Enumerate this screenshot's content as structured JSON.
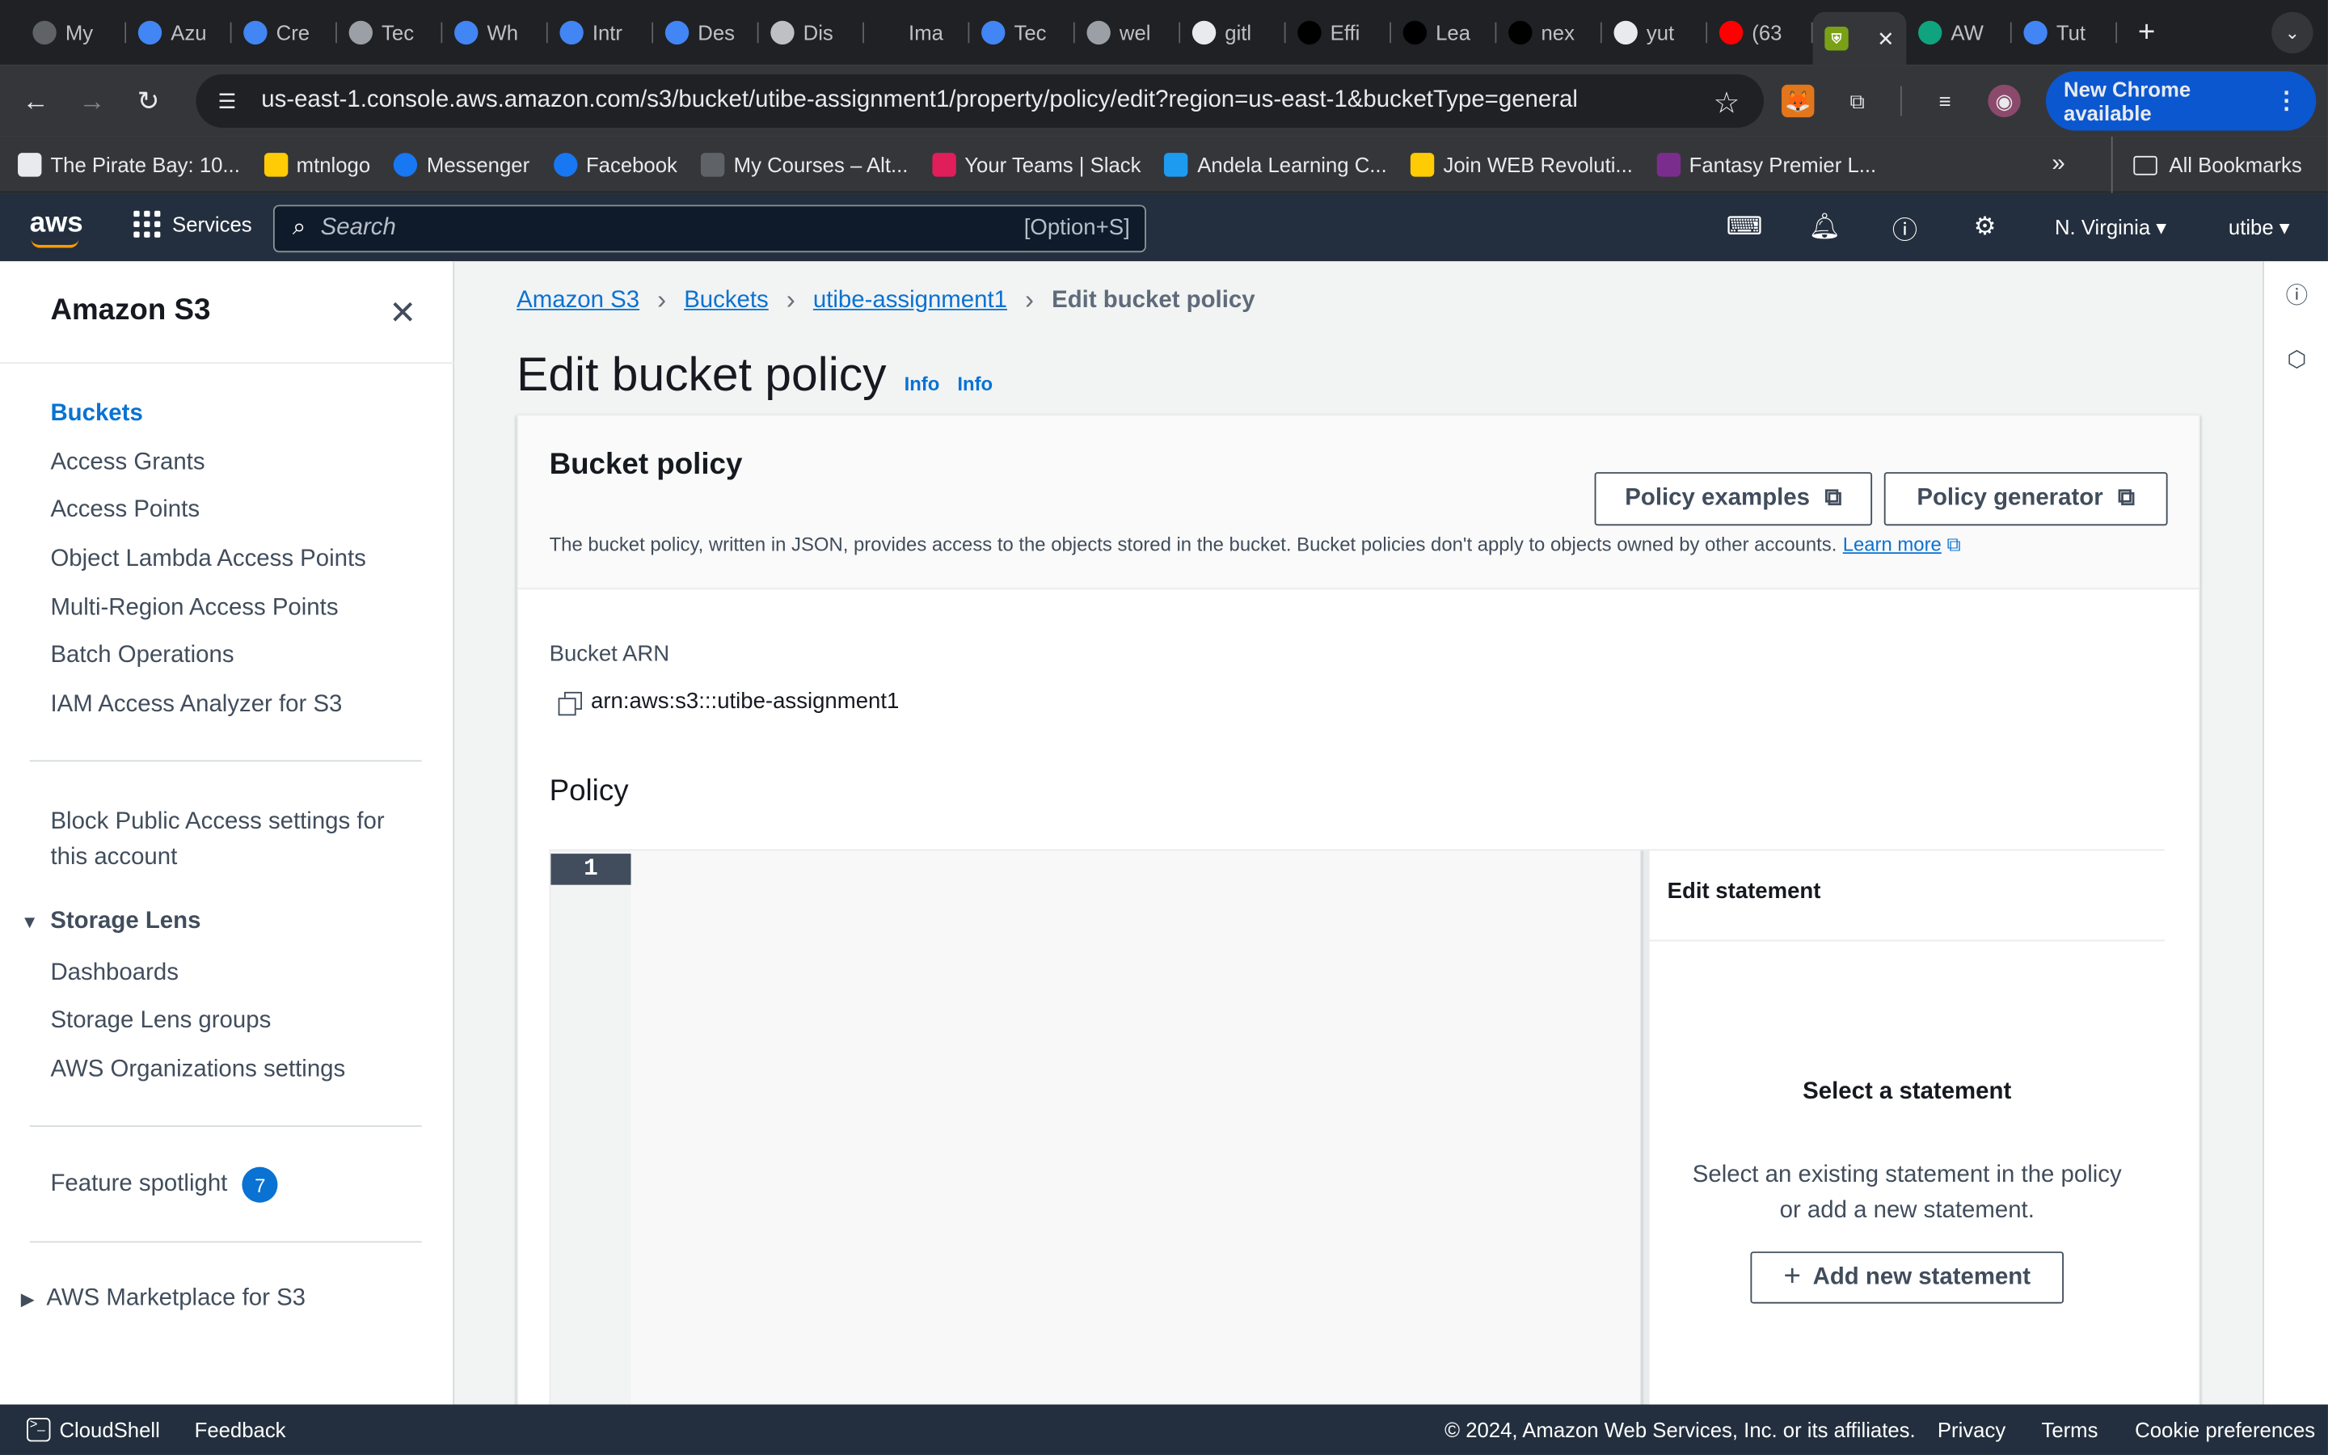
{
  "browser": {
    "tabs": [
      {
        "label": "My",
        "icon": "spinner-icon",
        "color": "#5f6368"
      },
      {
        "label": "Azu",
        "icon": "chrome-icon",
        "color": "#4285f4"
      },
      {
        "label": "Cre",
        "icon": "chrome-icon",
        "color": "#4285f4"
      },
      {
        "label": "Tec",
        "icon": "chatgpt-icon",
        "color": "#9aa0a6"
      },
      {
        "label": "Wh",
        "icon": "chrome-icon",
        "color": "#4285f4"
      },
      {
        "label": "Intr",
        "icon": "chrome-icon",
        "color": "#4285f4"
      },
      {
        "label": "Des",
        "icon": "chrome-icon",
        "color": "#4285f4"
      },
      {
        "label": "Dis",
        "icon": "v-icon",
        "color": "#bdc1c6"
      },
      {
        "label": "Ima",
        "icon": "openai-icon",
        "color": "#202124"
      },
      {
        "label": "Tec",
        "icon": "docs-icon",
        "color": "#4285f4"
      },
      {
        "label": "wel",
        "icon": "globe-icon",
        "color": "#9aa0a6"
      },
      {
        "label": "gitl",
        "icon": "github-icon",
        "color": "#e8eaed"
      },
      {
        "label": "Effi",
        "icon": "dev-icon",
        "color": "#000000"
      },
      {
        "label": "Lea",
        "icon": "n-icon",
        "color": "#000000"
      },
      {
        "label": "nex",
        "icon": "triangle-icon",
        "color": "#000000"
      },
      {
        "label": "yut",
        "icon": "github-icon",
        "color": "#e8eaed"
      },
      {
        "label": "(63",
        "icon": "youtube-icon",
        "color": "#ff0000"
      }
    ],
    "active_tab_icon": "aws-tab-icon",
    "after_tabs": [
      {
        "label": "AW",
        "icon": "chatgpt-icon",
        "color": "#10a37f"
      },
      {
        "label": "Tut",
        "icon": "edge-icon",
        "color": "#4285f4"
      }
    ],
    "url": "us-east-1.console.aws.amazon.com/s3/bucket/utibe-assignment1/property/policy/edit?region=us-east-1&bucketType=general",
    "new_chrome_label": "New Chrome available",
    "bookmarks": [
      {
        "label": "The Pirate Bay: 10...",
        "icon": "pirate-icon"
      },
      {
        "label": "mtnlogo",
        "icon": "mtn-icon"
      },
      {
        "label": "Messenger",
        "icon": "facebook-icon"
      },
      {
        "label": "Facebook",
        "icon": "facebook-icon"
      },
      {
        "label": "My Courses – Alt...",
        "icon": "folder-icon"
      },
      {
        "label": "Your Teams | Slack",
        "icon": "slack-icon"
      },
      {
        "label": "Andela Learning C...",
        "icon": "andela-icon"
      },
      {
        "label": "Join WEB Revoluti...",
        "icon": "web-icon"
      },
      {
        "label": "Fantasy Premier L...",
        "icon": "premier-league-icon"
      }
    ],
    "all_bookmarks_label": "All Bookmarks"
  },
  "aws_nav": {
    "logo": "aws",
    "services_label": "Services",
    "search_placeholder": "Search",
    "search_shortcut": "[Option+S]",
    "region": "N. Virginia",
    "user": "utibe"
  },
  "sidebar": {
    "title": "Amazon S3",
    "items": [
      {
        "label": "Buckets",
        "active": true
      },
      {
        "label": "Access Grants"
      },
      {
        "label": "Access Points"
      },
      {
        "label": "Object Lambda Access Points"
      },
      {
        "label": "Multi-Region Access Points"
      },
      {
        "label": "Batch Operations"
      },
      {
        "label": "IAM Access Analyzer for S3"
      }
    ],
    "block_public_access": "Block Public Access settings for this account",
    "storage_lens": {
      "label": "Storage Lens",
      "items": [
        "Dashboards",
        "Storage Lens groups",
        "AWS Organizations settings"
      ]
    },
    "feature_spotlight": {
      "label": "Feature spotlight",
      "count": "7"
    },
    "marketplace": "AWS Marketplace for S3"
  },
  "breadcrumb": [
    "Amazon S3",
    "Buckets",
    "utibe-assignment1",
    "Edit bucket policy"
  ],
  "page": {
    "title": "Edit bucket policy",
    "info_links": [
      "Info",
      "Info"
    ]
  },
  "bucket_policy": {
    "title": "Bucket policy",
    "policy_examples": "Policy examples",
    "policy_generator": "Policy generator",
    "description": "The bucket policy, written in JSON, provides access to the objects stored in the bucket. Bucket policies don't apply to objects owned by other accounts.",
    "learn_more": "Learn more",
    "arn_label": "Bucket ARN",
    "arn": "arn:aws:s3:::utibe-assignment1",
    "policy_heading": "Policy",
    "line_number": "1"
  },
  "statement_panel": {
    "title": "Edit statement",
    "select_title": "Select a statement",
    "select_desc": "Select an existing statement in the policy or add a new statement.",
    "add_button": "Add new statement"
  },
  "footer": {
    "cloudshell": "CloudShell",
    "feedback": "Feedback",
    "copyright": "© 2024, Amazon Web Services, Inc. or its affiliates.",
    "privacy": "Privacy",
    "terms": "Terms",
    "cookie": "Cookie preferences"
  }
}
